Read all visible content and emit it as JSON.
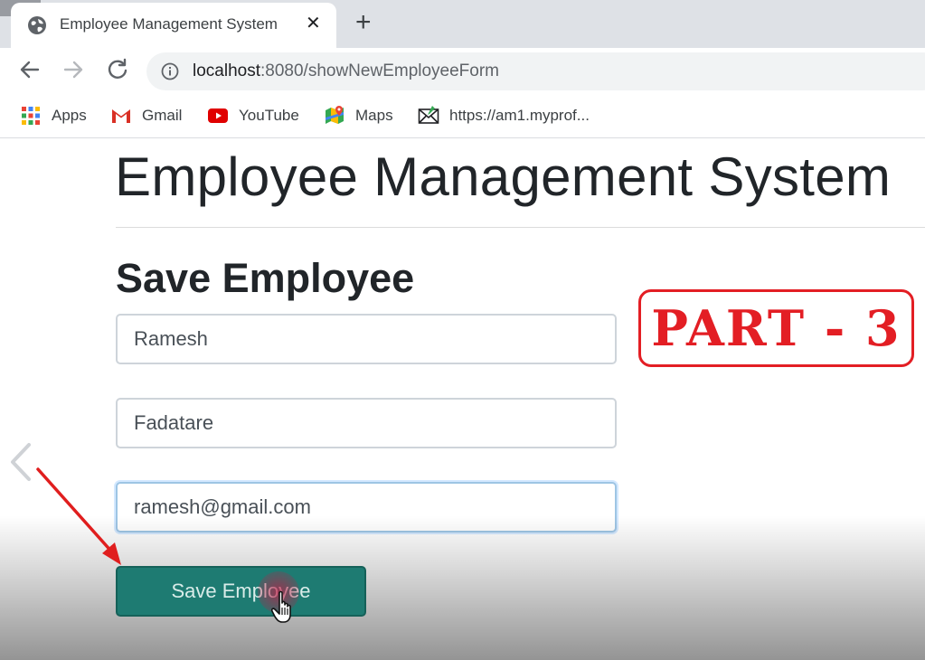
{
  "browser": {
    "tab": {
      "title": "Employee Management System",
      "close_glyph": "✕"
    },
    "new_tab_glyph": "+",
    "address": {
      "host": "localhost",
      "rest": ":8080/showNewEmployeeForm"
    },
    "bookmarks": [
      {
        "label": "Apps",
        "icon": "apps-grid-icon"
      },
      {
        "label": "Gmail",
        "icon": "gmail-icon"
      },
      {
        "label": "YouTube",
        "icon": "youtube-icon"
      },
      {
        "label": "Maps",
        "icon": "maps-icon"
      },
      {
        "label": "https://am1.myprof...",
        "icon": "mail-envelope-icon"
      }
    ]
  },
  "page": {
    "title": "Employee Management System",
    "form_title": "Save Employee",
    "fields": {
      "first_name": "Ramesh",
      "last_name": "Fadatare",
      "email": "ramesh@gmail.com"
    },
    "save_button": "Save Employee"
  },
  "overlay": {
    "badge_text": "PART - 3",
    "badge_color": "#e31e24",
    "arrow_color": "#e01e1e"
  },
  "colors": {
    "button_bg": "#1e7b72",
    "tabstrip_bg": "#dee1e6",
    "omnibox_bg": "#f1f3f4"
  }
}
